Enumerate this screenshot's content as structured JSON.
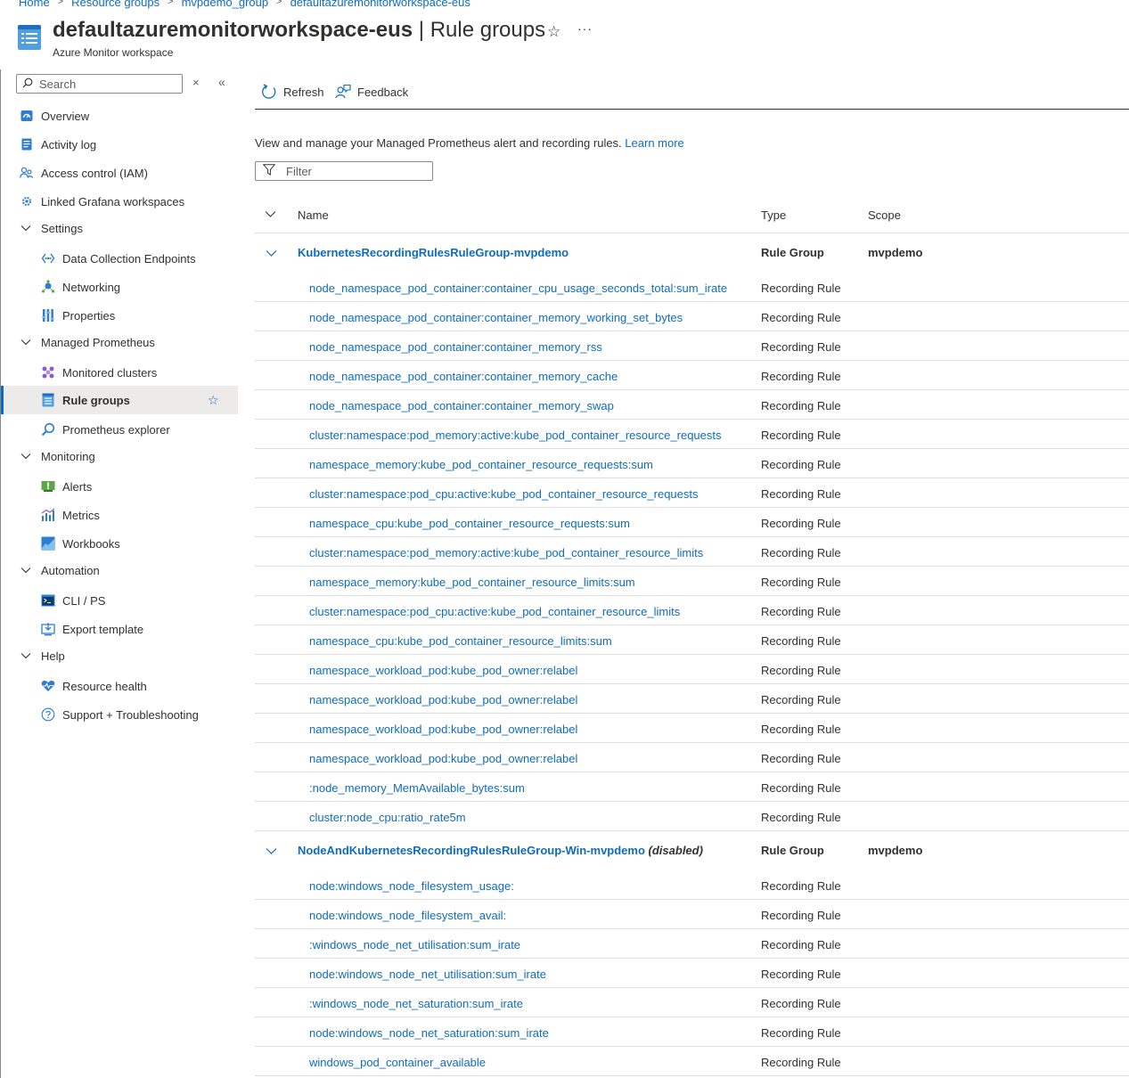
{
  "breadcrumb": [
    "Home",
    "Resource groups",
    "mvpdemo_group",
    "defaultazuremonitorworkspace-eus"
  ],
  "header": {
    "resource_name": "defaultazuremonitorworkspace-eus",
    "separator": " | ",
    "page_name": "Rule groups",
    "subtitle": "Azure Monitor workspace",
    "star_icon": "star-outline-icon",
    "more_label": "···"
  },
  "sidebar": {
    "search_placeholder": "Search",
    "close_label": "×",
    "collapse_label": "«",
    "items": [
      {
        "label": "Overview",
        "icon": "overview-icon",
        "level": 1
      },
      {
        "label": "Activity log",
        "icon": "activity-log-icon",
        "level": 1
      },
      {
        "label": "Access control (IAM)",
        "icon": "iam-icon",
        "level": 1
      },
      {
        "label": "Linked Grafana workspaces",
        "icon": "grafana-icon",
        "level": 1
      },
      {
        "label": "Settings",
        "level": "section"
      },
      {
        "label": "Data Collection Endpoints",
        "icon": "data-collection-icon",
        "level": 2
      },
      {
        "label": "Networking",
        "icon": "networking-icon",
        "level": 2
      },
      {
        "label": "Properties",
        "icon": "properties-icon",
        "level": 2
      },
      {
        "label": "Managed Prometheus",
        "level": "section"
      },
      {
        "label": "Monitored clusters",
        "icon": "clusters-icon",
        "level": 2
      },
      {
        "label": "Rule groups",
        "icon": "rule-groups-icon",
        "level": 2,
        "selected": true
      },
      {
        "label": "Prometheus explorer",
        "icon": "explorer-icon",
        "level": 2
      },
      {
        "label": "Monitoring",
        "level": "section"
      },
      {
        "label": "Alerts",
        "icon": "alerts-icon",
        "level": 2
      },
      {
        "label": "Metrics",
        "icon": "metrics-icon",
        "level": 2
      },
      {
        "label": "Workbooks",
        "icon": "workbooks-icon",
        "level": 2
      },
      {
        "label": "Automation",
        "level": "section"
      },
      {
        "label": "CLI / PS",
        "icon": "cli-icon",
        "level": 2
      },
      {
        "label": "Export template",
        "icon": "export-template-icon",
        "level": 2
      },
      {
        "label": "Help",
        "level": "section"
      },
      {
        "label": "Resource health",
        "icon": "resource-health-icon",
        "level": 2
      },
      {
        "label": "Support + Troubleshooting",
        "icon": "support-icon",
        "level": 2
      }
    ]
  },
  "toolbar": {
    "refresh_label": "Refresh",
    "feedback_label": "Feedback"
  },
  "intro": {
    "text": "View and manage your Managed Prometheus alert and recording rules. ",
    "link": "Learn more"
  },
  "filter": {
    "placeholder": "Filter"
  },
  "grid": {
    "columns": {
      "name": "Name",
      "type": "Type",
      "scope": "Scope"
    },
    "groups": [
      {
        "name": "KubernetesRecordingRulesRuleGroup-mvpdemo",
        "suffix": "",
        "type": "Rule Group",
        "scope": "mvpdemo",
        "rules": [
          {
            "name": "node_namespace_pod_container:container_cpu_usage_seconds_total:sum_irate",
            "type": "Recording Rule"
          },
          {
            "name": "node_namespace_pod_container:container_memory_working_set_bytes",
            "type": "Recording Rule"
          },
          {
            "name": "node_namespace_pod_container:container_memory_rss",
            "type": "Recording Rule"
          },
          {
            "name": "node_namespace_pod_container:container_memory_cache",
            "type": "Recording Rule"
          },
          {
            "name": "node_namespace_pod_container:container_memory_swap",
            "type": "Recording Rule"
          },
          {
            "name": "cluster:namespace:pod_memory:active:kube_pod_container_resource_requests",
            "type": "Recording Rule"
          },
          {
            "name": "namespace_memory:kube_pod_container_resource_requests:sum",
            "type": "Recording Rule"
          },
          {
            "name": "cluster:namespace:pod_cpu:active:kube_pod_container_resource_requests",
            "type": "Recording Rule"
          },
          {
            "name": "namespace_cpu:kube_pod_container_resource_requests:sum",
            "type": "Recording Rule"
          },
          {
            "name": "cluster:namespace:pod_memory:active:kube_pod_container_resource_limits",
            "type": "Recording Rule"
          },
          {
            "name": "namespace_memory:kube_pod_container_resource_limits:sum",
            "type": "Recording Rule"
          },
          {
            "name": "cluster:namespace:pod_cpu:active:kube_pod_container_resource_limits",
            "type": "Recording Rule"
          },
          {
            "name": "namespace_cpu:kube_pod_container_resource_limits:sum",
            "type": "Recording Rule"
          },
          {
            "name": "namespace_workload_pod:kube_pod_owner:relabel",
            "type": "Recording Rule"
          },
          {
            "name": "namespace_workload_pod:kube_pod_owner:relabel",
            "type": "Recording Rule"
          },
          {
            "name": "namespace_workload_pod:kube_pod_owner:relabel",
            "type": "Recording Rule"
          },
          {
            "name": "namespace_workload_pod:kube_pod_owner:relabel",
            "type": "Recording Rule"
          },
          {
            "name": ":node_memory_MemAvailable_bytes:sum",
            "type": "Recording Rule"
          },
          {
            "name": "cluster:node_cpu:ratio_rate5m",
            "type": "Recording Rule"
          }
        ]
      },
      {
        "name": "NodeAndKubernetesRecordingRulesRuleGroup-Win-mvpdemo",
        "suffix": "(disabled)",
        "type": "Rule Group",
        "scope": "mvpdemo",
        "rules": [
          {
            "name": "node:windows_node_filesystem_usage:",
            "type": "Recording Rule"
          },
          {
            "name": "node:windows_node_filesystem_avail:",
            "type": "Recording Rule"
          },
          {
            "name": ":windows_node_net_utilisation:sum_irate",
            "type": "Recording Rule"
          },
          {
            "name": "node:windows_node_net_utilisation:sum_irate",
            "type": "Recording Rule"
          },
          {
            "name": ":windows_node_net_saturation:sum_irate",
            "type": "Recording Rule"
          },
          {
            "name": "node:windows_node_net_saturation:sum_irate",
            "type": "Recording Rule"
          },
          {
            "name": "windows_pod_container_available",
            "type": "Recording Rule"
          }
        ]
      }
    ]
  },
  "colors": {
    "accent": "#0f6cbd",
    "text": "#323130",
    "selected_bg": "#edebe9",
    "border": "#e1dfdd"
  }
}
